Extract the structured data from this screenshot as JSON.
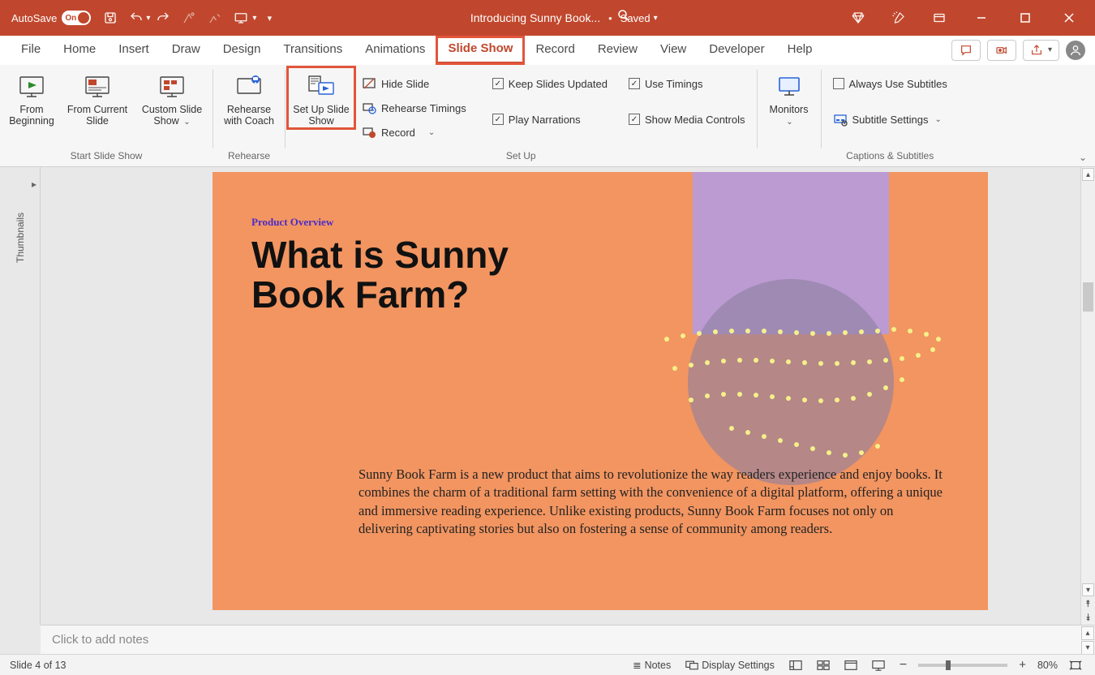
{
  "title_bar": {
    "autosave_label": "AutoSave",
    "autosave_state": "On",
    "document_title": "Introducing Sunny Book...",
    "saved_state": "Saved"
  },
  "tabs": {
    "file": "File",
    "home": "Home",
    "insert": "Insert",
    "draw": "Draw",
    "design": "Design",
    "transitions": "Transitions",
    "animations": "Animations",
    "slide_show": "Slide Show",
    "record": "Record",
    "review": "Review",
    "view": "View",
    "developer": "Developer",
    "help": "Help"
  },
  "ribbon": {
    "from_beginning": "From Beginning",
    "from_current": "From Current Slide",
    "custom_show": "Custom Slide Show",
    "group_start": "Start Slide Show",
    "rehearse_coach": "Rehearse with Coach",
    "group_rehearse": "Rehearse",
    "setup_show": "Set Up Slide Show",
    "hide_slide": "Hide Slide",
    "rehearse_timings": "Rehearse Timings",
    "record_btn": "Record",
    "keep_updated": "Keep Slides Updated",
    "play_narrations": "Play Narrations",
    "use_timings": "Use Timings",
    "show_media": "Show Media Controls",
    "group_setup": "Set Up",
    "monitors": "Monitors",
    "always_subtitles": "Always Use Subtitles",
    "subtitle_settings": "Subtitle Settings",
    "group_captions": "Captions & Subtitles"
  },
  "thumbnails_label": "Thumbnails",
  "slide": {
    "subtitle": "Product Overview",
    "title_line1": "What is Sunny",
    "title_line2": "Book Farm?",
    "body": "Sunny Book Farm is a new product that aims to revolutionize the way readers experience and enjoy books. It combines the charm of a traditional farm setting with the convenience of a digital platform, offering a unique and immersive reading experience. Unlike existing products, Sunny Book Farm focuses not only on delivering captivating stories but also on fostering a sense of community among readers."
  },
  "notes_placeholder": "Click to add notes",
  "status": {
    "slide_info": "Slide 4 of 13",
    "notes": "Notes",
    "display_settings": "Display Settings",
    "zoom": "80%"
  }
}
